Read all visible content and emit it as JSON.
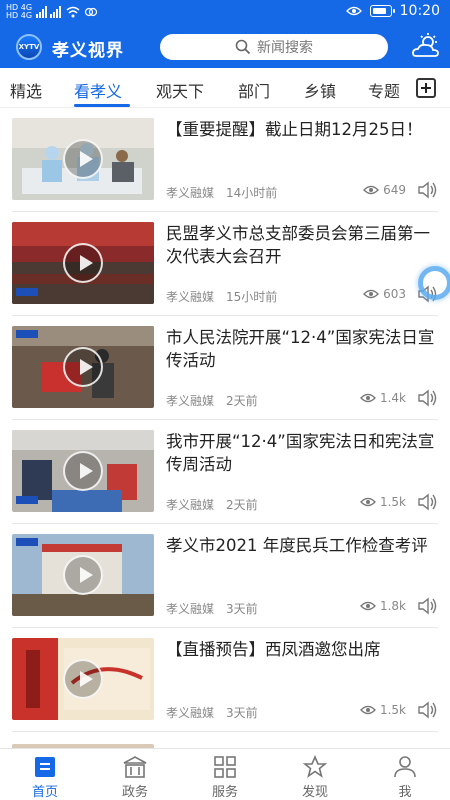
{
  "status_bar": {
    "left": [
      "HD",
      "4G",
      "HD",
      "4G"
    ],
    "time": "10:20",
    "battery_level": 0.85
  },
  "app": {
    "title": "孝义视界",
    "logo_text": "XYTV"
  },
  "search": {
    "placeholder": "新闻搜索"
  },
  "tabs": [
    {
      "label": "精选"
    },
    {
      "label": "看孝义",
      "active": true
    },
    {
      "label": "观天下"
    },
    {
      "label": "部门"
    },
    {
      "label": "乡镇"
    },
    {
      "label": "专题"
    }
  ],
  "news": [
    {
      "title": "【重要提醒】截止日期12月25日！",
      "source": "孝义融媒",
      "time": "14小时前",
      "views": "649"
    },
    {
      "title": "民盟孝义市总支部委员会第三届第一次代表大会召开",
      "source": "孝义融媒",
      "time": "15小时前",
      "views": "603"
    },
    {
      "title": "市人民法院开展“12·4”国家宪法日宣传活动",
      "source": "孝义融媒",
      "time": "2天前",
      "views": "1.4k"
    },
    {
      "title": "我市开展“12·4”国家宪法日和宪法宣传周活动",
      "source": "孝义融媒",
      "time": "2天前",
      "views": "1.5k"
    },
    {
      "title": "孝义市2021 年度民兵工作检查考评",
      "source": "孝义融媒",
      "time": "3天前",
      "views": "1.8k"
    },
    {
      "title": "【直播预告】西凤酒邀您出席",
      "source": "孝义融媒",
      "time": "3天前",
      "views": "1.5k"
    }
  ],
  "bottom_nav": [
    {
      "label": "首页",
      "icon": "home-icon",
      "active": true
    },
    {
      "label": "政务",
      "icon": "government-icon"
    },
    {
      "label": "服务",
      "icon": "grid-icon"
    },
    {
      "label": "发现",
      "icon": "star-icon"
    },
    {
      "label": "我",
      "icon": "user-icon"
    }
  ],
  "colors": {
    "primary": "#1669e6",
    "text": "#222222",
    "meta": "#888888"
  }
}
